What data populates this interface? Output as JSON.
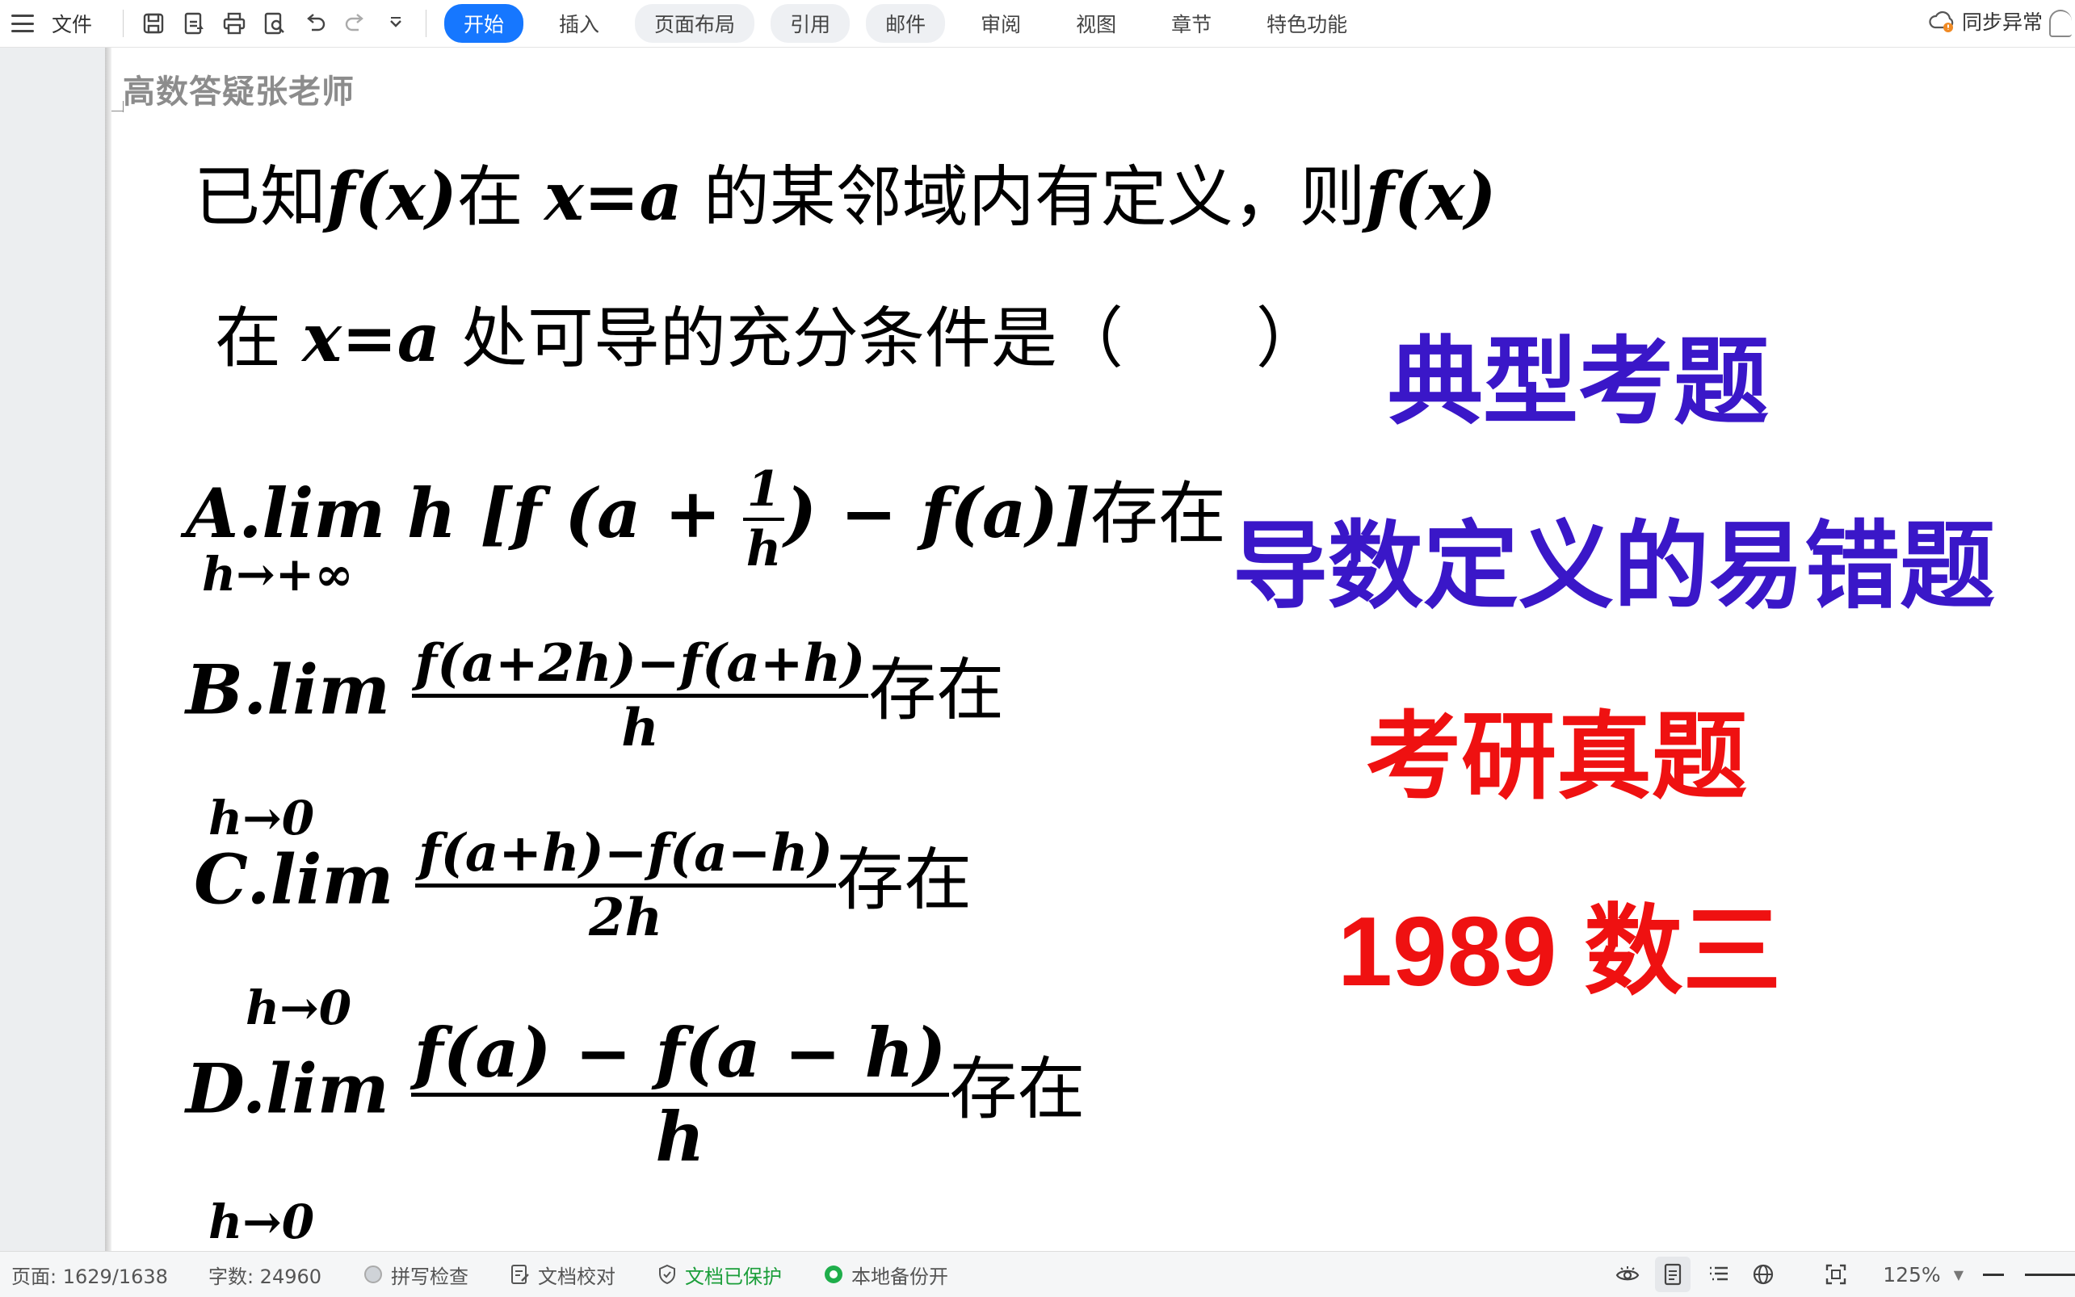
{
  "ribbon": {
    "file_label": "文件",
    "tabs": [
      "开始",
      "插入",
      "页面布局",
      "引用",
      "邮件",
      "审阅",
      "视图",
      "章节",
      "特色功能"
    ],
    "active_tab": "开始",
    "sync_label": "同步异常"
  },
  "document": {
    "watermark": "高数答疑张老师",
    "question": {
      "l1_a": "已知",
      "l1_fx": "f(x)",
      "l1_b": "在",
      "l1_xa": "x=a",
      "l1_c": "的某邻域内有定义，则",
      "l1_fx2": "f(x)",
      "l2_a": "在",
      "l2_xa": "x=a",
      "l2_b": "处可导的充分条件是（　　）"
    },
    "options": {
      "A": {
        "label": "A.",
        "lim": "lim",
        "sub": "h→+∞",
        "pre": "h [f (a +",
        "num": "1",
        "den": "h",
        "post": ") − f(a)]",
        "tail": "存在"
      },
      "B": {
        "label": "B.",
        "lim": "lim",
        "sub": "h→0",
        "num": "f(a+2h)−f(a+h)",
        "den": "h",
        "tail": "存在"
      },
      "C": {
        "label": "C.",
        "lim": "lim",
        "sub": "h→0",
        "num": "f(a+h)−f(a−h)",
        "den": "2h",
        "tail": "存在"
      },
      "D": {
        "label": "D.",
        "lim": "lim",
        "sub": "h→0",
        "num": "f(a) − f(a − h)",
        "den": "h",
        "tail": "存在"
      }
    },
    "tags": {
      "typical": "典型考题",
      "error_prone": "导数定义的易错题",
      "exam": "考研真题",
      "year": "1989 数三"
    },
    "colors": {
      "purple": "#3a17c8",
      "red": "#ef1111",
      "accent": "#1677ff"
    }
  },
  "status": {
    "page": "页面: 1629/1638",
    "words": "字数: 24960",
    "spell": "拼写检查",
    "proof": "文档校对",
    "protected": "文档已保护",
    "backup": "本地备份开",
    "zoom": "125%"
  }
}
